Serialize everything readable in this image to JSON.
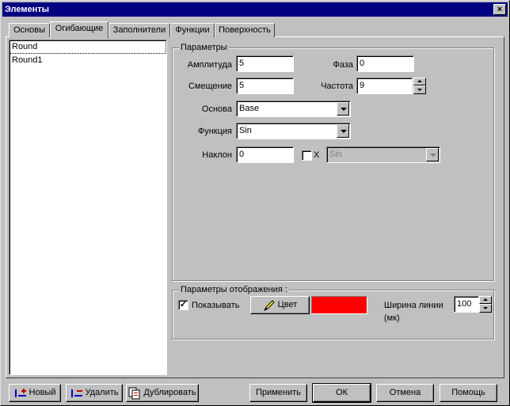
{
  "window": {
    "title": "Элементы",
    "close_glyph": "×"
  },
  "tabs": [
    {
      "label": "Основы"
    },
    {
      "label": "Огибающие"
    },
    {
      "label": "Заполнители"
    },
    {
      "label": "Функции"
    },
    {
      "label": "Поверхность"
    }
  ],
  "list": {
    "items": [
      "Round",
      "Round1"
    ]
  },
  "params": {
    "title": "Параметры",
    "amplitude_label": "Амплитуда",
    "amplitude_value": "5",
    "phase_label": "Фаза",
    "phase_value": "0",
    "offset_label": "Смещение",
    "offset_value": "5",
    "frequency_label": "Частота",
    "frequency_value": "9",
    "base_label": "Основа",
    "base_value": "Base",
    "function_label": "Функция",
    "function_value": "Sin",
    "slope_label": "Наклон",
    "slope_value": "0",
    "x_label": "X",
    "x_checked": false,
    "x_function_value": "Sin"
  },
  "display": {
    "title": "Параметры отображения :",
    "show_label": "Показывать",
    "show_checked": true,
    "check_glyph": "✓",
    "color_button": "Цвет",
    "color_value": "#ff0000",
    "line_width_label": "Ширина линии (мк)",
    "line_width_value": "100"
  },
  "buttons": {
    "new": "Новый",
    "delete": "Удалить",
    "duplicate": "Дублировать",
    "apply": "Применить",
    "ok": "ОК",
    "cancel": "Отмена",
    "help": "Помощь"
  }
}
